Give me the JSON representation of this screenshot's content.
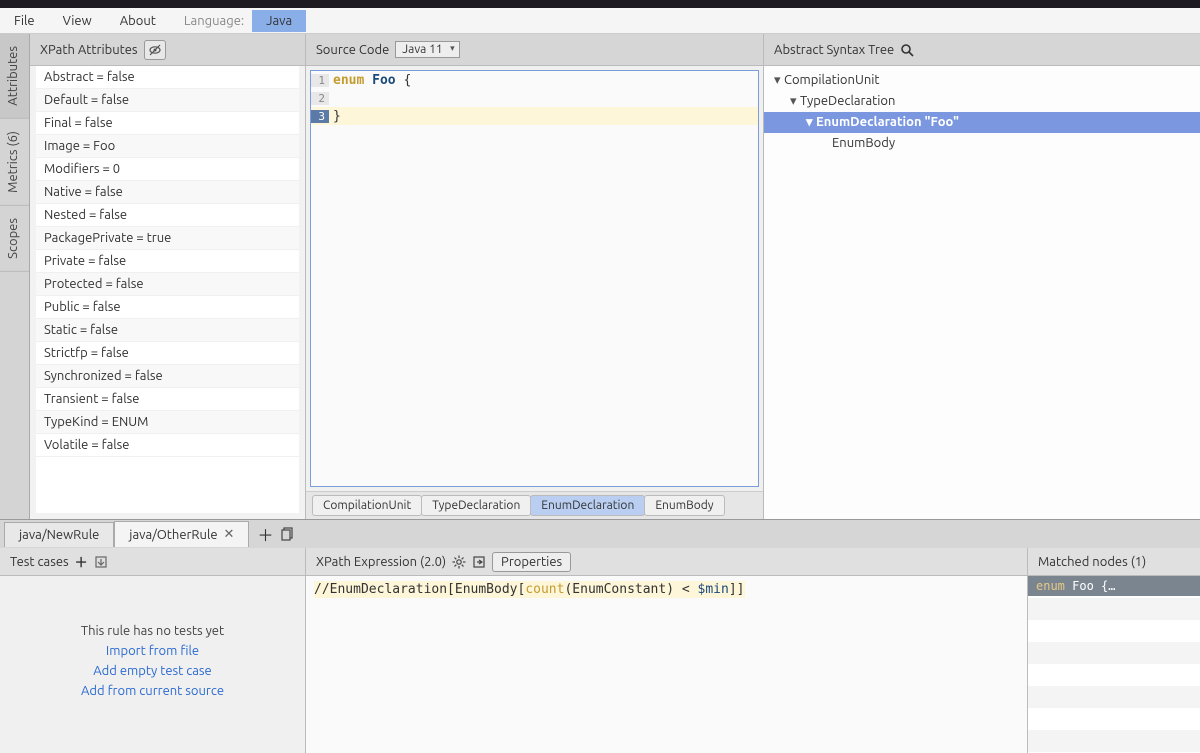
{
  "menubar": {
    "file": "File",
    "view": "View",
    "about": "About",
    "language_label": "Language:",
    "language_active": "Java"
  },
  "vtabs": {
    "attributes": "Attributes",
    "metrics": "Metrics   (6)",
    "scopes": "Scopes"
  },
  "xpath_panel": {
    "title": "XPath Attributes"
  },
  "attributes": [
    "Abstract = false",
    "Default = false",
    "Final = false",
    "Image = Foo",
    "Modifiers = 0",
    "Native = false",
    "Nested = false",
    "PackagePrivate = true",
    "Private = false",
    "Protected = false",
    "Public = false",
    "Static = false",
    "Strictfp = false",
    "Synchronized = false",
    "Transient = false",
    "TypeKind = ENUM",
    "Volatile = false"
  ],
  "source_panel": {
    "title": "Source Code",
    "lang_version": "Java 11",
    "code": {
      "l1": {
        "kw": "enum",
        "name": "Foo",
        "rest": " {"
      },
      "l2": "",
      "l3": "}"
    }
  },
  "breadcrumbs": [
    "CompilationUnit",
    "TypeDeclaration",
    "EnumDeclaration",
    "EnumBody"
  ],
  "ast_panel": {
    "title": "Abstract Syntax Tree"
  },
  "ast": {
    "n0": "CompilationUnit",
    "n1": "TypeDeclaration",
    "n2": "EnumDeclaration \"Foo\"",
    "n3": "EnumBody"
  },
  "rule_tabs": {
    "t0": "java/NewRule",
    "t1": "java/OtherRule"
  },
  "tests_panel": {
    "title": "Test cases",
    "empty_msg": "This rule has no tests yet",
    "link_import": "Import from file",
    "link_add_empty": "Add empty test case",
    "link_add_source": "Add from current source"
  },
  "xpath_expr_panel": {
    "title": "XPath Expression (2.0)",
    "props_btn": "Properties",
    "expr": {
      "pre": "//EnumDeclaration[EnumBody[",
      "fn": "count",
      "mid": "(EnumConstant) < ",
      "var": "$min",
      "post": "]]"
    }
  },
  "matched_panel": {
    "title": "Matched nodes (1)",
    "row": {
      "kw": "enum",
      "rest": " Foo {…"
    }
  }
}
